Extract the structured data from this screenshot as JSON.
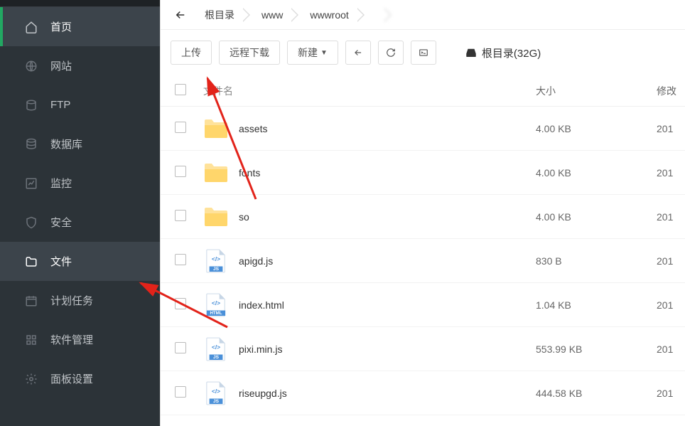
{
  "sidebar": {
    "items": [
      {
        "label": "首页",
        "icon": "home",
        "active": true
      },
      {
        "label": "网站",
        "icon": "globe",
        "active": false
      },
      {
        "label": "FTP",
        "icon": "ftp",
        "active": false
      },
      {
        "label": "数据库",
        "icon": "database",
        "active": false
      },
      {
        "label": "监控",
        "icon": "chart",
        "active": false
      },
      {
        "label": "安全",
        "icon": "shield",
        "active": false
      },
      {
        "label": "文件",
        "icon": "folder",
        "active": true
      },
      {
        "label": "计划任务",
        "icon": "calendar",
        "active": false
      },
      {
        "label": "软件管理",
        "icon": "grid",
        "active": false
      },
      {
        "label": "面板设置",
        "icon": "gear",
        "active": false
      }
    ]
  },
  "breadcrumb": {
    "items": [
      "根目录",
      "www",
      "wwwroot",
      ""
    ]
  },
  "toolbar": {
    "upload_label": "上传",
    "remote_label": "远程下载",
    "new_label": "新建",
    "disk_label": "根目录(32G)"
  },
  "table": {
    "headers": {
      "name": "文件名",
      "size": "大小",
      "date": "修改"
    },
    "rows": [
      {
        "name": "assets",
        "type": "folder",
        "size": "4.00 KB",
        "date": "201"
      },
      {
        "name": "fonts",
        "type": "folder",
        "size": "4.00 KB",
        "date": "201"
      },
      {
        "name": "so",
        "type": "folder",
        "size": "4.00 KB",
        "date": "201"
      },
      {
        "name": "apigd.js",
        "type": "js",
        "size": "830 B",
        "date": "201"
      },
      {
        "name": "index.html",
        "type": "html",
        "size": "1.04 KB",
        "date": "201"
      },
      {
        "name": "pixi.min.js",
        "type": "js",
        "size": "553.99 KB",
        "date": "201"
      },
      {
        "name": "riseupgd.js",
        "type": "js",
        "size": "444.58 KB",
        "date": "201"
      }
    ]
  }
}
